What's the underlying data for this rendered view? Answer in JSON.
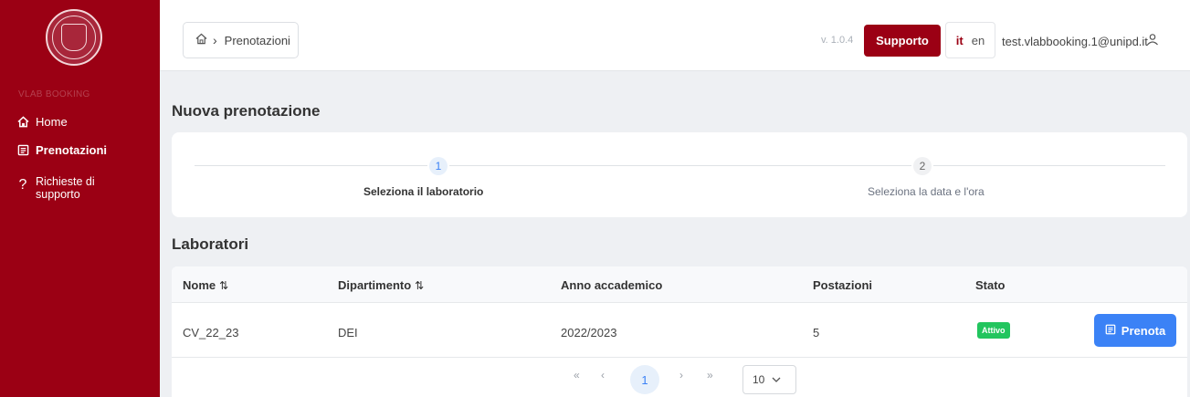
{
  "sidebar": {
    "brand": "VLAB BOOKING",
    "items": [
      {
        "label": "Home",
        "icon": "home-icon"
      },
      {
        "label": "Prenotazioni",
        "icon": "list-icon",
        "active": true
      },
      {
        "label": "Richieste di supporto",
        "icon": "question-icon"
      }
    ]
  },
  "header": {
    "breadcrumb": {
      "home_icon": "home-icon",
      "current": "Prenotazioni"
    },
    "version": "v. 1.0.4",
    "support_label": "Supporto",
    "languages": {
      "active": "it",
      "other": "en"
    },
    "user_email": "test.vlabbooking.1@unipd.it",
    "user_icon": "user-icon"
  },
  "page": {
    "title": "Nuova prenotazione",
    "steps": [
      {
        "number": "1",
        "label": "Seleziona il laboratorio",
        "active": true
      },
      {
        "number": "2",
        "label": "Seleziona la data e l'ora",
        "active": false
      }
    ]
  },
  "labs": {
    "title": "Laboratori",
    "columns": {
      "nome": "Nome",
      "dipartimento": "Dipartimento",
      "anno": "Anno accademico",
      "postazioni": "Postazioni",
      "stato": "Stato"
    },
    "rows": [
      {
        "nome": "CV_22_23",
        "dipartimento": "DEI",
        "anno": "2022/2023",
        "postazioni": "5",
        "stato": "Attivo",
        "action": "Prenota"
      }
    ],
    "pagination": {
      "first": "«",
      "prev": "‹",
      "current": "1",
      "next": "›",
      "last": "»",
      "rows_per_page": "10"
    }
  },
  "colors": {
    "brand": "#9b0014",
    "primary": "#3b82f6",
    "success": "#22c55e"
  }
}
